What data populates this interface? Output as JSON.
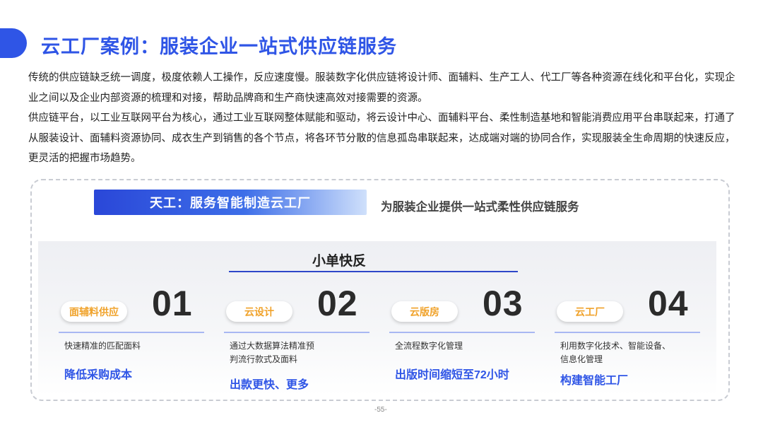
{
  "title": "云工厂案例：服装企业一站式供应链服务",
  "intro": {
    "p1": "传统的供应链缺乏统一调度，极度依赖人工操作，反应速度慢。服装数字化供应链将设计师、面辅料、生产工人、代工厂等各种资源在线化和平台化，实现企业之间以及企业内部资源的梳理和对接，帮助品牌商和生产商快速高效对接需要的资源。",
    "p2": "供应链平台，以工业互联网平台为核心，通过工业互联网整体赋能和驱动，将云设计中心、面辅料平台、柔性制造基地和智能消费应用平台串联起来，打通了从服装设计、面辅料资源协同、成衣生产到销售的各个节点，将各环节分散的信息孤岛串联起来，达成端对端的协同合作，实现服装全生命周期的快速反应，更灵活的把握市场趋势。"
  },
  "banner": "天工：服务智能制造云工厂",
  "subtitle": "为服装企业提供一站式柔性供应链服务",
  "center_title": "小单快反",
  "items": [
    {
      "pill": "面辅料供应",
      "num": "01",
      "desc": "快速精准的匹配面料",
      "result": "降低采购成本"
    },
    {
      "pill": "云设计",
      "num": "02",
      "desc": "通过大数据算法精准预判流行款式及面料",
      "result": "出款更快、更多"
    },
    {
      "pill": "云版房",
      "num": "03",
      "desc": "全流程数字化管理",
      "result": "出版时间缩短至72小时"
    },
    {
      "pill": "云工厂",
      "num": "04",
      "desc": "利用数字化技术、智能设备、信息化管理",
      "result": "构建智能工厂"
    }
  ],
  "page_number": "-55-",
  "colors": {
    "accent": "#2f55e6",
    "pill_text": "#f0a22a"
  }
}
